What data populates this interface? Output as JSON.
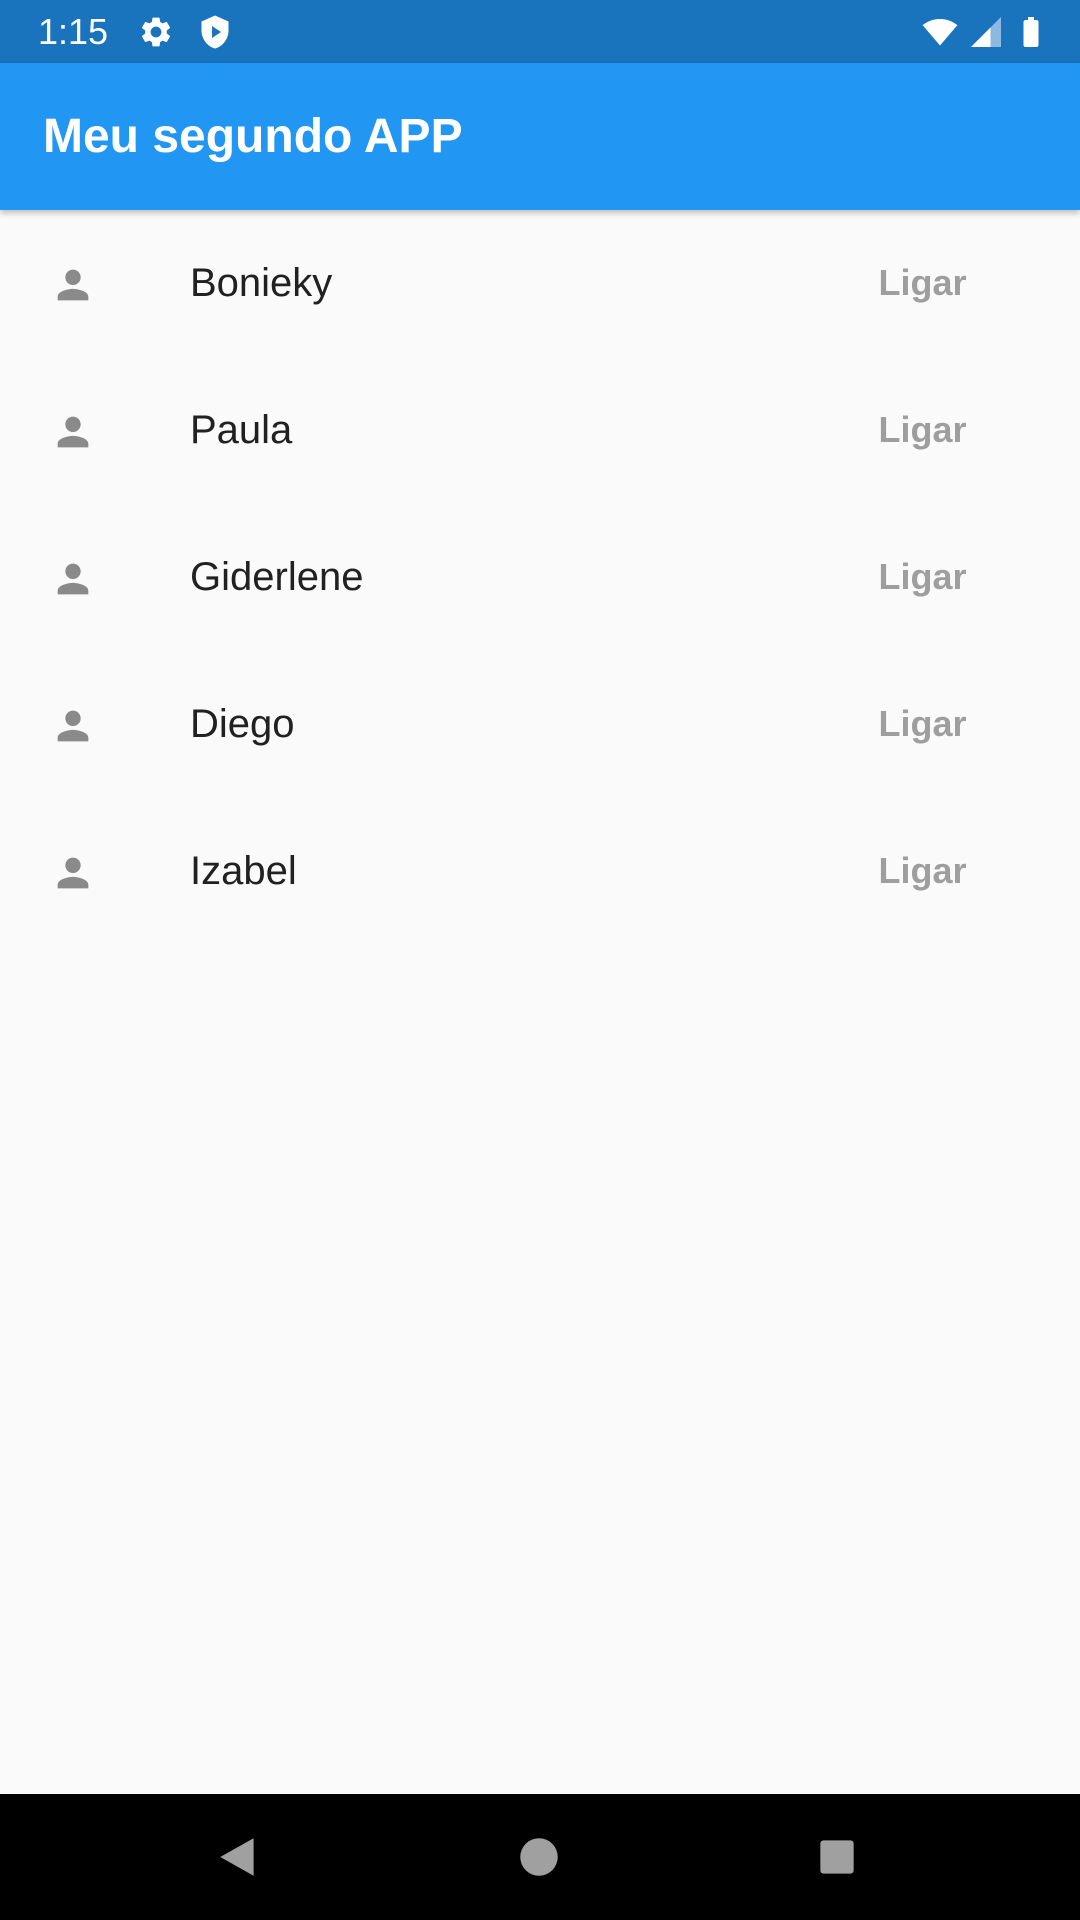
{
  "status_bar": {
    "time": "1:15",
    "icons": [
      "gear-icon",
      "shield-play-icon",
      "wifi-icon",
      "signal-icon",
      "battery-icon"
    ],
    "background": "#1a73bd"
  },
  "app_bar": {
    "title": "Meu segundo APP",
    "background": "#2196f3"
  },
  "contacts": [
    {
      "name": "Bonieky",
      "action": "Ligar",
      "icon": "person-icon"
    },
    {
      "name": "Paula",
      "action": "Ligar",
      "icon": "person-icon"
    },
    {
      "name": "Giderlene",
      "action": "Ligar",
      "icon": "person-icon"
    },
    {
      "name": "Diego",
      "action": "Ligar",
      "icon": "person-icon"
    },
    {
      "name": "Izabel",
      "action": "Ligar",
      "icon": "person-icon"
    }
  ],
  "nav_bar": {
    "buttons": [
      "back-icon",
      "home-icon",
      "recents-icon"
    ]
  },
  "colors": {
    "icon_gray": "#8a8a8a",
    "action_gray": "#9e9e9e",
    "text": "#212121"
  }
}
